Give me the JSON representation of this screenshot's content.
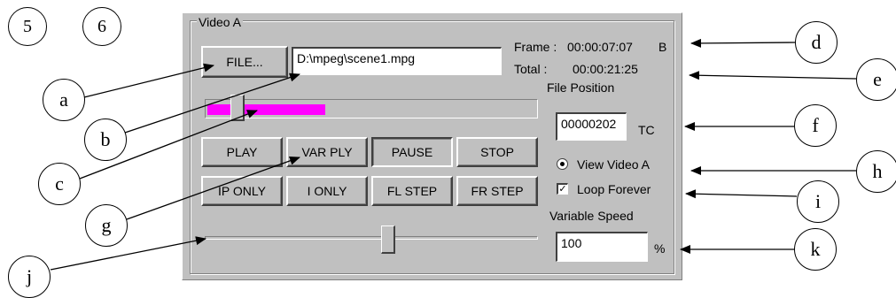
{
  "figure_numbers": [
    "5",
    "6"
  ],
  "panel": {
    "group_title": "Video A",
    "file_button": "FILE...",
    "file_path": "D:\\mpeg\\scene1.mpg",
    "frame_label": "Frame :",
    "frame_value": "00:00:07:07",
    "frame_suffix": "B",
    "total_label": "Total :",
    "total_value": "00:00:21:25",
    "file_position_label": "File Position",
    "file_position_value": "00000202",
    "file_position_unit": "TC",
    "position_slider_fraction": 0.07,
    "progress_fraction": 0.36,
    "progress_color": "#ff00ff",
    "speed_slider_fraction": 0.53,
    "buttons_row1": [
      "PLAY",
      "VAR PLY",
      "PAUSE",
      "STOP"
    ],
    "buttons_row2": [
      "IP ONLY",
      "I ONLY",
      "FL STEP",
      "FR STEP"
    ],
    "pressed_button": "PAUSE",
    "view_video_label": "View Video A",
    "view_video_selected": true,
    "loop_forever_label": "Loop Forever",
    "loop_forever_checked": true,
    "checkbox_glyph": "✓",
    "variable_speed_label": "Variable Speed",
    "variable_speed_value": "100",
    "variable_speed_unit": "%"
  },
  "callouts": {
    "a": "a",
    "b": "b",
    "c": "c",
    "d": "d",
    "e": "e",
    "f": "f",
    "g": "g",
    "h": "h",
    "i": "i",
    "j": "j",
    "k": "k"
  }
}
